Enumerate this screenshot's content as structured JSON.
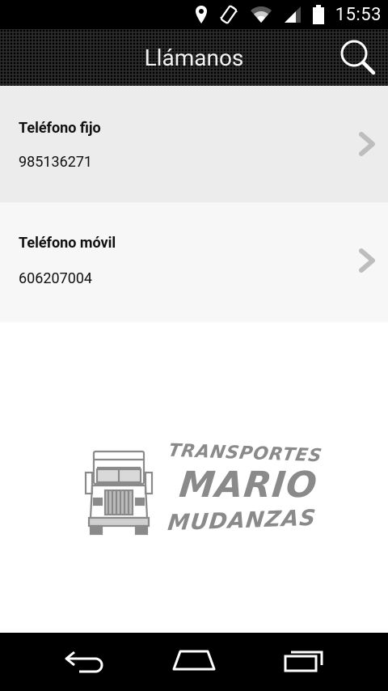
{
  "status_bar": {
    "time": "15:53",
    "icons": [
      "location-icon",
      "rotation-lock-icon",
      "wifi-icon",
      "signal-icon",
      "battery-icon"
    ]
  },
  "action_bar": {
    "title": "Llámanos",
    "search_icon": "search-icon"
  },
  "contacts": [
    {
      "label": "Teléfono fijo",
      "number": "985136271"
    },
    {
      "label": "Teléfono móvil",
      "number": "606207004"
    }
  ],
  "logo": {
    "line1": "TRANSPORTES",
    "line2": "MARIO",
    "line3": "MUDANZAS"
  },
  "nav_bar": {
    "icons": [
      "back-icon",
      "home-icon",
      "recent-apps-icon"
    ]
  },
  "colors": {
    "status_bar_bg": "#000000",
    "action_bar_bg": "#2b2b2b",
    "row_fixed_bg": "#ececec",
    "row_mobile_bg": "#f7f7f7",
    "logo_gray": "#8a8a8a"
  }
}
